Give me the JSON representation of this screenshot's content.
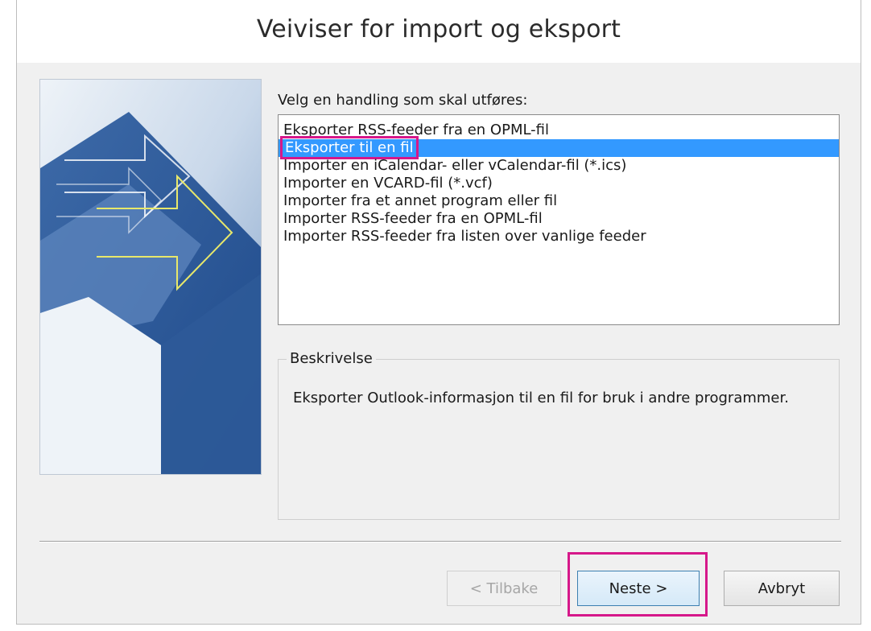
{
  "window": {
    "title": "Veiviser for import og eksport"
  },
  "prompt": "Velg en handling som skal utføres:",
  "actions": {
    "items": [
      "Eksporter RSS-feeder fra en OPML-fil",
      "Eksporter til en fil",
      "Importer en iCalendar- eller vCalendar-fil (*.ics)",
      "Importer en VCARD-fil (*.vcf)",
      "Importer fra et annet program eller fil",
      "Importer RSS-feeder fra en OPML-fil",
      "Importer RSS-feeder fra listen over vanlige feeder"
    ],
    "selected_index": 1
  },
  "description": {
    "label": "Beskrivelse",
    "text": "Eksporter Outlook-informasjon til en fil for bruk i andre programmer."
  },
  "buttons": {
    "back": "< Tilbake",
    "next": "Neste >",
    "cancel": "Avbryt"
  },
  "colors": {
    "selection": "#3399ff",
    "highlight": "#d6188a"
  },
  "icons": {
    "wizard_art": "import-export-arrows-illustration"
  }
}
